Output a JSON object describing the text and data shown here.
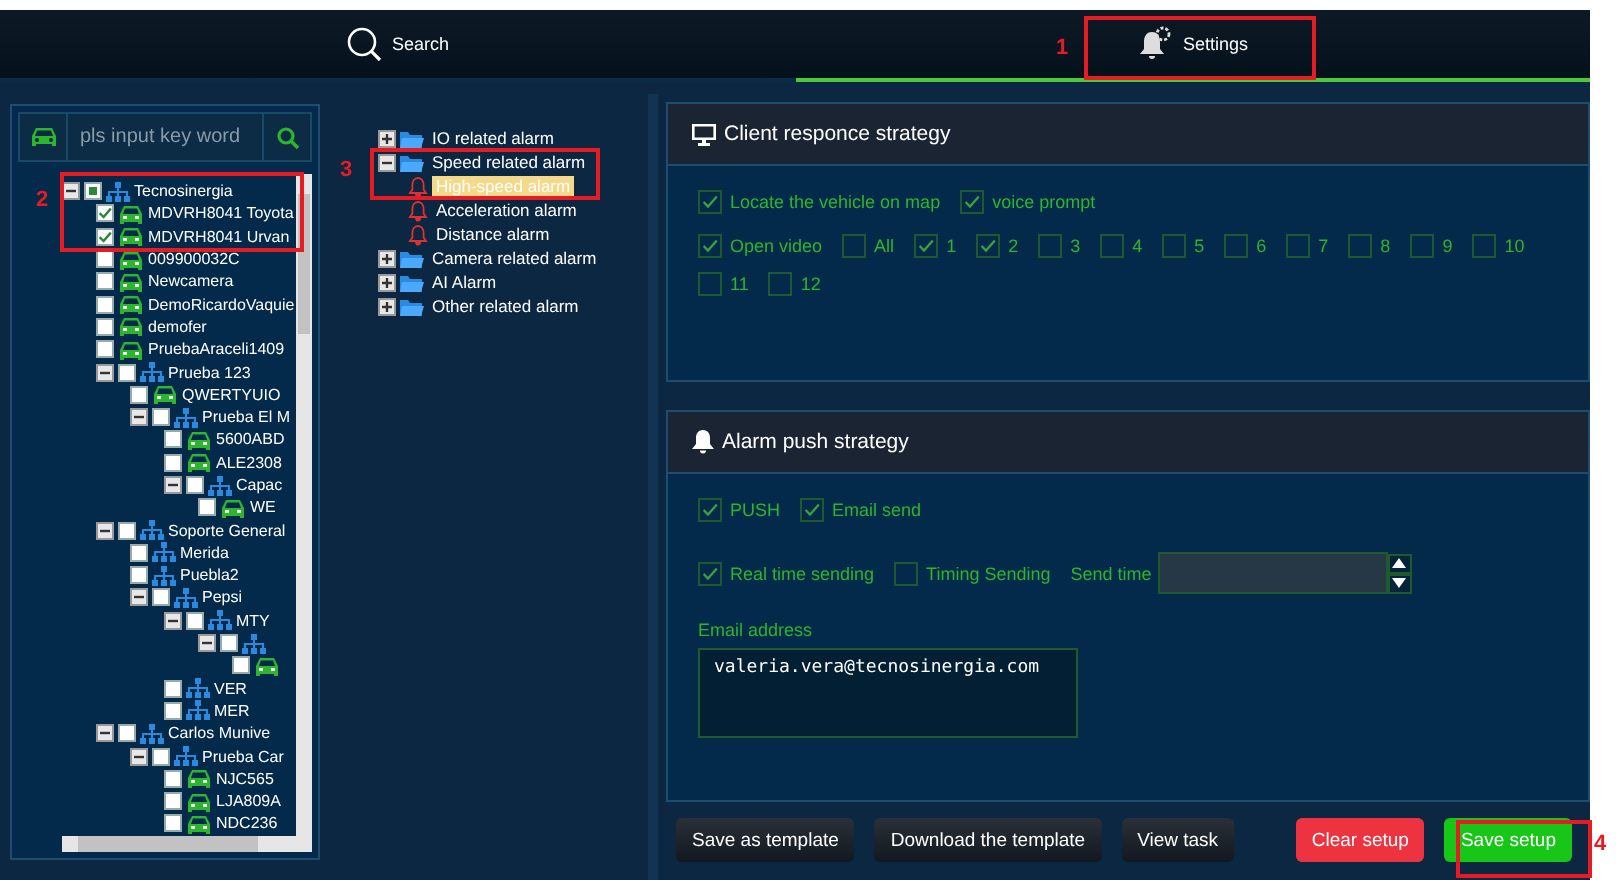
{
  "tabs": [
    {
      "label": "Search",
      "selected": false
    },
    {
      "label": "Settings",
      "selected": true
    }
  ],
  "vehicle_search": {
    "placeholder": "pls input key word"
  },
  "vehicle_tree": [
    {
      "label": "Tecnosinergia",
      "kind": "group",
      "checked": false,
      "partial": true,
      "expanded": true,
      "children": [
        {
          "label": "MDVRH8041 Toyota",
          "kind": "vehicle",
          "checked": true,
          "partial": false
        },
        {
          "label": "MDVRH8041 Urvan",
          "kind": "vehicle",
          "checked": true,
          "partial": false
        },
        {
          "label": "009900032C",
          "kind": "vehicle",
          "checked": false,
          "partial": false
        },
        {
          "label": "Newcamera",
          "kind": "vehicle",
          "checked": false,
          "partial": false
        },
        {
          "label": "DemoRicardoVaquie",
          "kind": "vehicle",
          "checked": false,
          "partial": false
        },
        {
          "label": "demofer",
          "kind": "vehicle",
          "checked": false,
          "partial": false
        },
        {
          "label": "PruebaAraceli1409",
          "kind": "vehicle",
          "checked": false,
          "partial": false
        },
        {
          "label": "Prueba 123",
          "kind": "group",
          "checked": false,
          "partial": false,
          "expanded": true,
          "children": [
            {
              "label": "QWERTYUIO",
              "kind": "vehicle",
              "checked": false,
              "partial": false
            },
            {
              "label": "Prueba El M",
              "kind": "group",
              "checked": false,
              "partial": false,
              "expanded": true,
              "children": [
                {
                  "label": "5600ABD",
                  "kind": "vehicle",
                  "checked": false,
                  "partial": false
                },
                {
                  "label": "ALE2308",
                  "kind": "vehicle",
                  "checked": false,
                  "partial": false
                },
                {
                  "label": "Capac",
                  "kind": "group",
                  "checked": false,
                  "partial": false,
                  "expanded": true,
                  "children": [
                    {
                      "label": "WE",
                      "kind": "vehicle",
                      "checked": false,
                      "partial": false
                    }
                  ]
                }
              ]
            }
          ]
        },
        {
          "label": "Soporte General",
          "kind": "group",
          "checked": false,
          "partial": false,
          "expanded": true,
          "children": [
            {
              "label": "Merida",
              "kind": "group",
              "checked": false,
              "partial": false
            },
            {
              "label": "Puebla2",
              "kind": "group",
              "checked": false,
              "partial": false
            },
            {
              "label": "Pepsi",
              "kind": "group",
              "checked": false,
              "partial": false,
              "expanded": true,
              "children": [
                {
                  "label": "MTY",
                  "kind": "group",
                  "checked": false,
                  "partial": false,
                  "expanded": true,
                  "children": [
                    {
                      "kind": "group",
                      "checked": false,
                      "partial": false,
                      "expanded": true,
                      "children": [
                        {
                          "kind": "vehicle",
                          "checked": false,
                          "partial": false
                        }
                      ]
                    }
                  ]
                },
                {
                  "label": "VER",
                  "kind": "group",
                  "checked": false,
                  "partial": false
                },
                {
                  "label": "MER",
                  "kind": "group",
                  "checked": false,
                  "partial": false
                }
              ]
            }
          ]
        },
        {
          "label": "Carlos Munive",
          "kind": "group",
          "checked": false,
          "partial": false,
          "expanded": true,
          "children": [
            {
              "label": "Prueba Car",
              "kind": "group",
              "checked": false,
              "partial": false,
              "expanded": true,
              "children": [
                {
                  "label": "NJC565",
                  "kind": "vehicle",
                  "checked": false,
                  "partial": false
                },
                {
                  "label": "LJA809A",
                  "kind": "vehicle",
                  "checked": false,
                  "partial": false
                },
                {
                  "label": "NDC236",
                  "kind": "vehicle",
                  "checked": false,
                  "partial": false
                }
              ]
            }
          ]
        }
      ]
    }
  ],
  "alarm_tree": [
    {
      "label": "IO related alarm",
      "kind": "folder",
      "expanded": false,
      "selected": false
    },
    {
      "label": "Speed related alarm",
      "kind": "folder",
      "expanded": true,
      "selected": false,
      "children": [
        {
          "label": "High-speed alarm",
          "kind": "alarm",
          "selected": true
        },
        {
          "label": "Acceleration alarm",
          "kind": "alarm",
          "selected": false
        },
        {
          "label": "Distance alarm",
          "kind": "alarm",
          "selected": false
        }
      ]
    },
    {
      "label": "Camera related alarm",
      "kind": "folder",
      "expanded": false,
      "selected": false
    },
    {
      "label": "AI Alarm",
      "kind": "folder",
      "expanded": false,
      "selected": false
    },
    {
      "label": "Other related alarm",
      "kind": "folder",
      "expanded": false,
      "selected": false
    }
  ],
  "client_strategy": {
    "title": "Client responce strategy",
    "rows": [
      {
        "options": [
          {
            "kind": "checkbox",
            "label": "Locate the vehicle on map",
            "checked": true
          },
          {
            "kind": "checkbox",
            "label": "voice prompt",
            "checked": true
          }
        ]
      },
      {
        "options": [
          {
            "kind": "checkbox",
            "label": "Open video",
            "checked": true
          },
          {
            "kind": "checkbox",
            "label": "All",
            "checked": false
          },
          {
            "kind": "checkbox",
            "label": "1",
            "checked": true
          },
          {
            "kind": "checkbox",
            "label": "2",
            "checked": true
          },
          {
            "kind": "checkbox",
            "label": "3",
            "checked": false
          },
          {
            "kind": "checkbox",
            "label": "4",
            "checked": false
          },
          {
            "kind": "checkbox",
            "label": "5",
            "checked": false
          },
          {
            "kind": "checkbox",
            "label": "6",
            "checked": false
          },
          {
            "kind": "checkbox",
            "label": "7",
            "checked": false
          },
          {
            "kind": "checkbox",
            "label": "8",
            "checked": false
          },
          {
            "kind": "checkbox",
            "label": "9",
            "checked": false
          },
          {
            "kind": "checkbox",
            "label": "10",
            "checked": false
          },
          {
            "kind": "checkbox",
            "label": "11",
            "checked": false
          },
          {
            "kind": "checkbox",
            "label": "12",
            "checked": false
          }
        ]
      }
    ]
  },
  "alarm_push": {
    "title": "Alarm push strategy",
    "rows": [
      {
        "options": [
          {
            "kind": "checkbox",
            "label": "PUSH",
            "checked": true
          },
          {
            "kind": "checkbox",
            "label": "Email send",
            "checked": true
          }
        ]
      },
      {
        "options": [
          {
            "kind": "checkbox",
            "label": "Real time sending",
            "checked": true
          },
          {
            "kind": "checkbox",
            "label": "Timing Sending",
            "checked": false
          },
          {
            "kind": "spin",
            "label": "Send time"
          }
        ]
      }
    ],
    "email": {
      "label": "Email address",
      "value": "valeria.vera@tecnosinergia.com"
    }
  },
  "buttons": [
    {
      "label": "Save as template",
      "kind": "default"
    },
    {
      "label": "Download the template",
      "kind": "default"
    },
    {
      "label": "View task",
      "kind": "default"
    },
    {
      "label": "Clear setup",
      "kind": "danger"
    },
    {
      "label": "Save setup",
      "kind": "primary"
    }
  ],
  "annotations": [
    {
      "number": "1"
    },
    {
      "number": "2"
    },
    {
      "number": "3"
    },
    {
      "number": "4"
    }
  ]
}
